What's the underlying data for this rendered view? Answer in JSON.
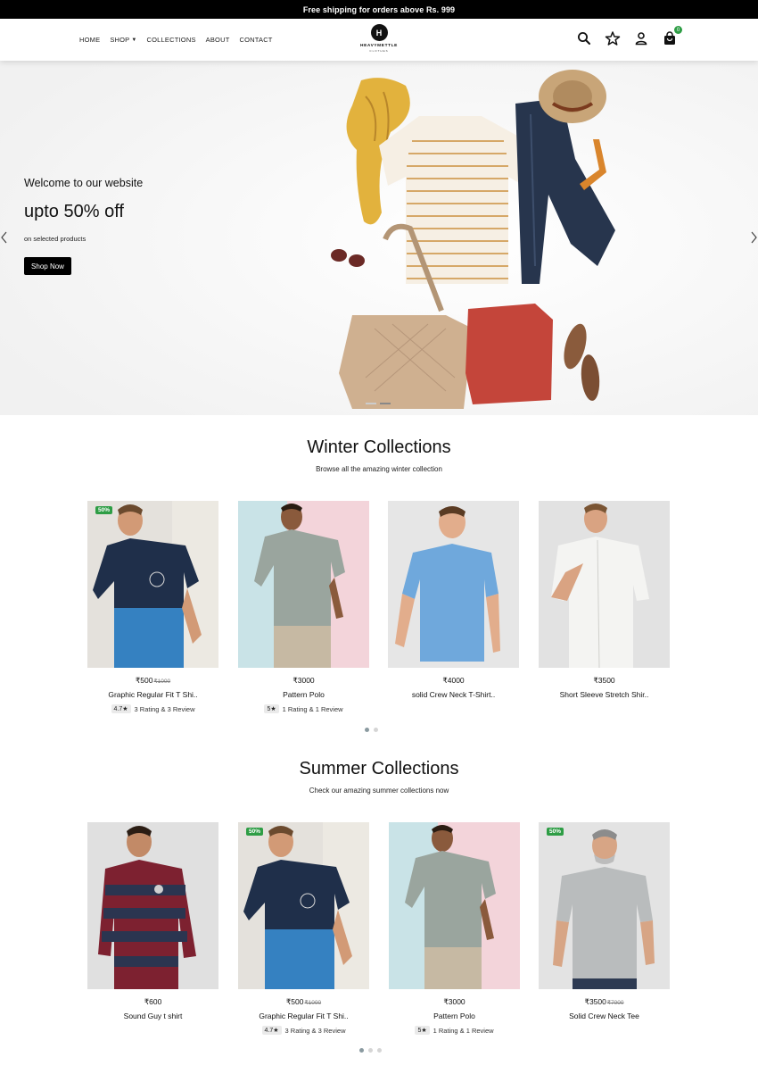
{
  "announcement": "Free shipping for orders above Rs. 999",
  "nav": {
    "items": [
      {
        "label": "HOME"
      },
      {
        "label": "SHOP"
      },
      {
        "label": "COLLECTIONS"
      },
      {
        "label": "ABOUT"
      },
      {
        "label": "CONTACT"
      }
    ]
  },
  "logo": {
    "mark": "H",
    "word": "HEAVYMETTLE",
    "sub": "CLOTHES"
  },
  "header_icons": [
    "search-icon",
    "star-icon",
    "user-icon",
    "shopping-bag-icon"
  ],
  "cart_count": "0",
  "hero": {
    "kicker": "Welcome to our website",
    "title": "upto 50% off",
    "subtitle": "on selected products",
    "cta": "Shop Now",
    "slides_total": 2,
    "active_slide": 1
  },
  "winter": {
    "title": "Winter Collections",
    "subtitle": "Browse all the amazing winter collection",
    "products": [
      {
        "badge": "50%",
        "price": "₹500",
        "old_price": "₹1000",
        "name": "Graphic Regular Fit T Shi..",
        "score": "4.7★",
        "reviews": "3 Rating & 3 Review"
      },
      {
        "badge": "",
        "price": "₹3000",
        "old_price": "",
        "name": "Pattern Polo",
        "score": "5★",
        "reviews": "1 Rating & 1 Review"
      },
      {
        "badge": "",
        "price": "₹4000",
        "old_price": "",
        "name": "solid Crew Neck T-Shirt..",
        "score": "",
        "reviews": ""
      },
      {
        "badge": "",
        "price": "₹3500",
        "old_price": "",
        "name": "Short Sleeve Stretch Shir..",
        "score": "",
        "reviews": ""
      }
    ],
    "pages": 2,
    "active_page": 1
  },
  "summer": {
    "title": "Summer Collections",
    "subtitle": "Check our amazing summer collections now",
    "products": [
      {
        "badge": "",
        "price": "₹600",
        "old_price": "",
        "name": "Sound Guy t shirt",
        "score": "",
        "reviews": ""
      },
      {
        "badge": "50%",
        "price": "₹500",
        "old_price": "₹1000",
        "name": "Graphic Regular Fit T Shi..",
        "score": "4.7★",
        "reviews": "3 Rating & 3 Review"
      },
      {
        "badge": "",
        "price": "₹3000",
        "old_price": "",
        "name": "Pattern Polo",
        "score": "5★",
        "reviews": "1 Rating & 1 Review"
      },
      {
        "badge": "50%",
        "price": "₹3500",
        "old_price": "₹7000",
        "name": "Solid Crew Neck Tee",
        "score": "",
        "reviews": ""
      }
    ],
    "pages": 3,
    "active_page": 1
  },
  "colors": {
    "badge_green": "#2e9d45",
    "shirt_navy": "#1f2f4a",
    "shirt_blue": "#3a8fd6",
    "shirt_grey": "#9aa59e",
    "shirt_white": "#f4f4f2",
    "shirt_maroon": "#7d2130",
    "shirt_lightgrey": "#b9bcbd"
  }
}
